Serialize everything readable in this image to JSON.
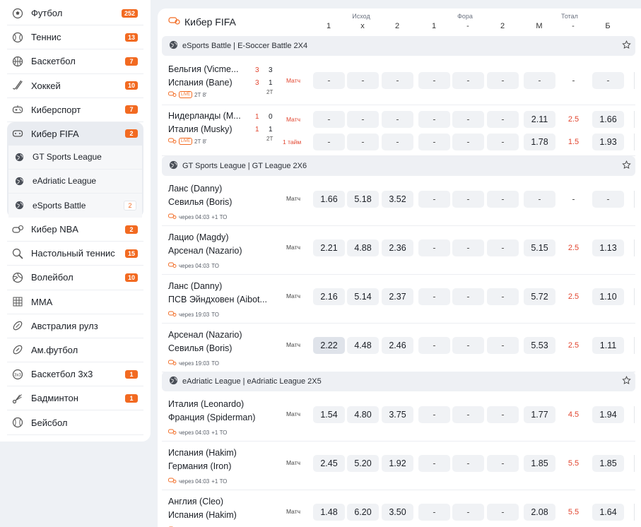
{
  "sidebar": {
    "items_top": [
      {
        "label": "Футбол",
        "count": "252",
        "icon": "soccer-ball-icon"
      },
      {
        "label": "Теннис",
        "count": "13",
        "icon": "tennis-ball-icon"
      },
      {
        "label": "Баскетбол",
        "count": "7",
        "icon": "basketball-icon"
      },
      {
        "label": "Хоккей",
        "count": "10",
        "icon": "hockey-stick-icon"
      },
      {
        "label": "Киберспорт",
        "count": "7",
        "icon": "gamepad-icon"
      }
    ],
    "active": {
      "label": "Кибер FIFA",
      "count": "2",
      "icon": "cyber-fifa-icon"
    },
    "sub_items": [
      {
        "label": "GT Sports League",
        "count": ""
      },
      {
        "label": "eAdriatic League",
        "count": ""
      },
      {
        "label": "eSports Battle",
        "count": "2"
      }
    ],
    "items_bottom": [
      {
        "label": "Кибер NBA",
        "count": "2",
        "icon": "cyber-nba-icon"
      },
      {
        "label": "Настольный теннис",
        "count": "15",
        "icon": "table-tennis-icon"
      },
      {
        "label": "Волейбол",
        "count": "10",
        "icon": "volleyball-icon"
      },
      {
        "label": "MMA",
        "count": "",
        "icon": "mma-icon"
      },
      {
        "label": "Австралия рулз",
        "count": "",
        "icon": "aussie-rules-icon"
      },
      {
        "label": "Ам.футбол",
        "count": "",
        "icon": "american-football-icon"
      },
      {
        "label": "Баскетбол 3х3",
        "count": "1",
        "icon": "basketball-3x3-icon"
      },
      {
        "label": "Бадминтон",
        "count": "1",
        "icon": "shuttlecock-icon"
      },
      {
        "label": "Бейсбол",
        "count": "",
        "icon": "baseball-icon"
      }
    ]
  },
  "header": {
    "title": "Кибер FIFA",
    "groups": {
      "outcome": "Исход",
      "handicap": "Фора",
      "total": "Тотал"
    },
    "cols": [
      "1",
      "х",
      "2",
      "1",
      "-",
      "2",
      "М",
      "-",
      "Б"
    ]
  },
  "sections": [
    {
      "title": "eSports Battle | E-Soccer Battle 2X4"
    },
    {
      "title": "GT Sports League | GT League 2X6"
    },
    {
      "title": "eAdriatic League | eAdriatic League 2X5"
    }
  ],
  "live_matches": [
    {
      "team1": "Бельгия (Vicme...",
      "team2": "Испания (Bane)",
      "s1a": "3",
      "s1b": "3",
      "s2a": "3",
      "s2b": "1",
      "period": "2Т",
      "live": "LIVE",
      "time": "2Т 8'",
      "lines": [
        {
          "type": "Матч",
          "odds": [
            "-",
            "-",
            "-",
            "-",
            "-",
            "-",
            "-",
            "-",
            "-"
          ]
        }
      ]
    },
    {
      "team1": "Нидерланды (M...",
      "team2": "Италия (Musky)",
      "s1a": "1",
      "s1b": "0",
      "s2a": "1",
      "s2b": "1",
      "period": "2Т",
      "live": "LIVE",
      "time": "2Т 8'",
      "lines": [
        {
          "type": "Матч",
          "odds": [
            "-",
            "-",
            "-",
            "-",
            "-",
            "-",
            "2.11",
            "2.5",
            "1.66"
          ]
        },
        {
          "type": "1 тайм",
          "odds": [
            "-",
            "-",
            "-",
            "-",
            "-",
            "-",
            "1.78",
            "1.5",
            "1.93"
          ]
        }
      ]
    }
  ],
  "prematch": [
    {
      "team1": "Ланс (Danny)",
      "team2": "Севилья (Boris)",
      "time": "через 04:03",
      "extra": "+1 ТО",
      "type": "Матч",
      "odds": [
        "1.66",
        "5.18",
        "3.52",
        "-",
        "-",
        "-",
        "-",
        "-",
        "-"
      ]
    },
    {
      "team1": "Лацио (Magdy)",
      "team2": "Арсенал (Nazario)",
      "time": "через 04:03",
      "extra": "ТО",
      "type": "Матч",
      "odds": [
        "2.21",
        "4.88",
        "2.36",
        "-",
        "-",
        "-",
        "5.15",
        "2.5",
        "1.13"
      ]
    },
    {
      "team1": "Ланс (Danny)",
      "team2": "ПСВ Эйндховен (Aibot...",
      "time": "через 19:03",
      "extra": "ТО",
      "type": "Матч",
      "odds": [
        "2.16",
        "5.14",
        "2.37",
        "-",
        "-",
        "-",
        "5.72",
        "2.5",
        "1.10"
      ]
    },
    {
      "team1": "Арсенал (Nazario)",
      "team2": "Севилья (Boris)",
      "time": "через 19:03",
      "extra": "ТО",
      "type": "Матч",
      "odds": [
        "2.22",
        "4.48",
        "2.46",
        "-",
        "-",
        "-",
        "5.53",
        "2.5",
        "1.11"
      ]
    },
    {
      "team1": "Италия (Leonardo)",
      "team2": "Франция (Spiderman)",
      "time": "через 04:03",
      "extra": "+1 ТО",
      "type": "Матч",
      "odds": [
        "1.54",
        "4.80",
        "3.75",
        "-",
        "-",
        "-",
        "1.77",
        "4.5",
        "1.94"
      ]
    },
    {
      "team1": "Испания (Hakim)",
      "team2": "Германия (Iron)",
      "time": "через 04:03",
      "extra": "+1 ТО",
      "type": "Матч",
      "odds": [
        "2.45",
        "5.20",
        "1.92",
        "-",
        "-",
        "-",
        "1.85",
        "5.5",
        "1.85"
      ]
    },
    {
      "team1": "Англия (Cleo)",
      "team2": "Испания (Hakim)",
      "time": "через 19:03",
      "extra": "+1 ТО",
      "type": "Матч",
      "odds": [
        "1.48",
        "6.20",
        "3.50",
        "-",
        "-",
        "-",
        "2.08",
        "5.5",
        "1.64"
      ]
    }
  ]
}
